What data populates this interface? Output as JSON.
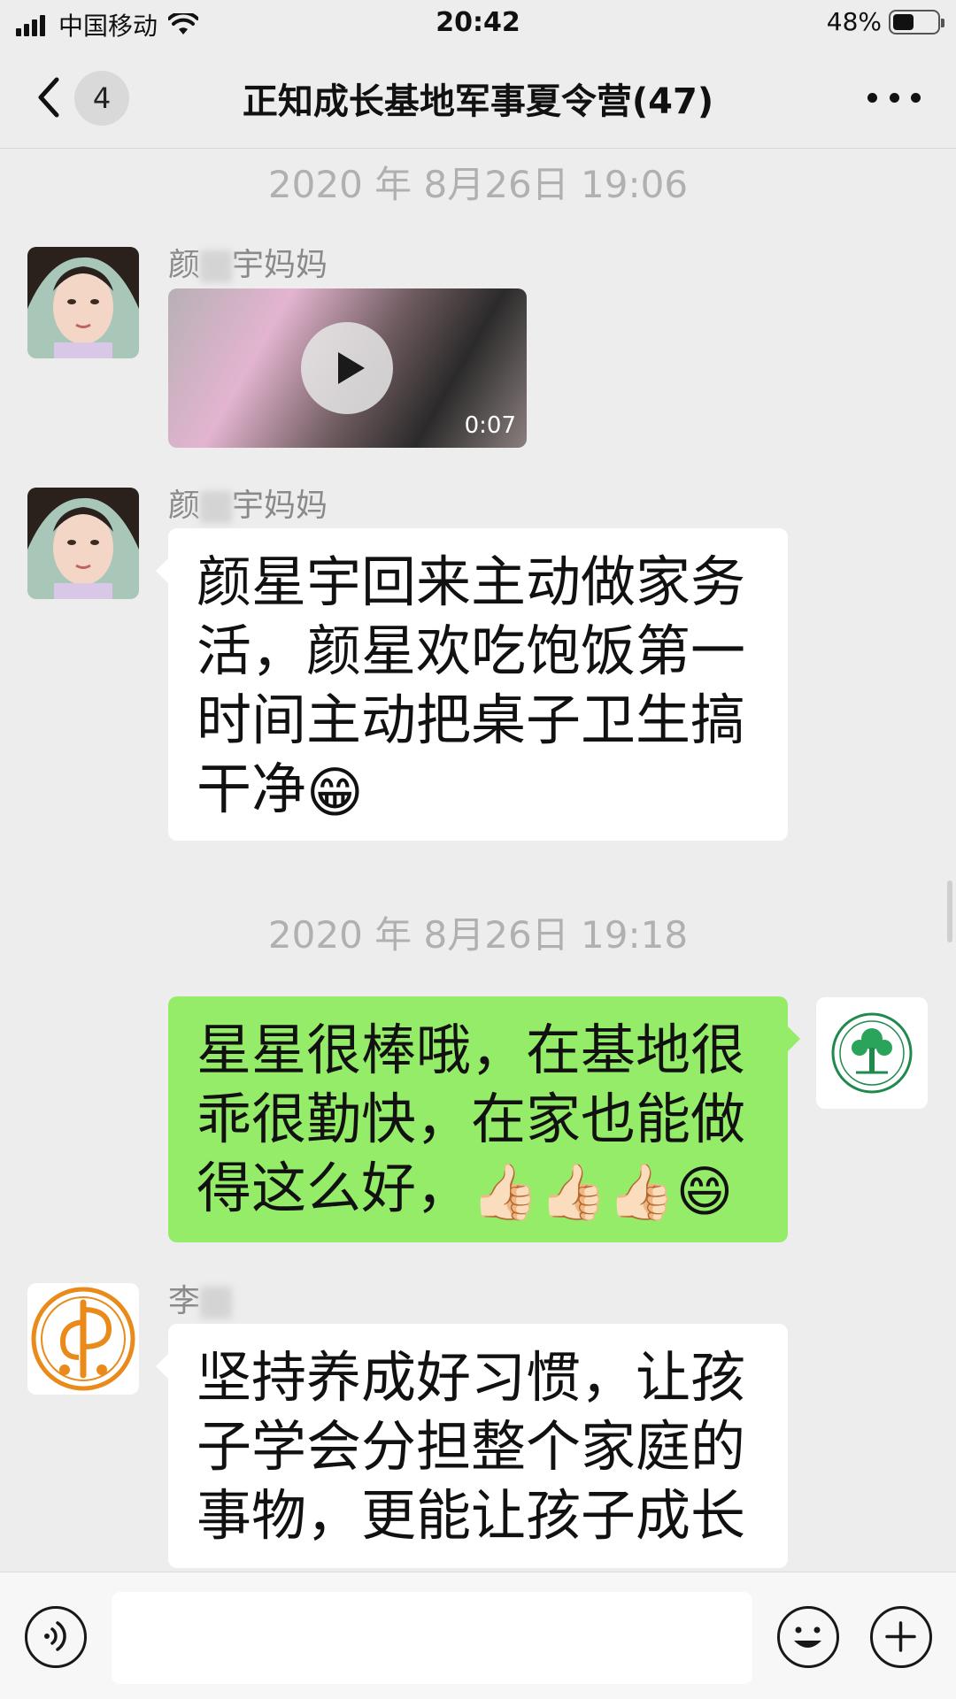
{
  "status_bar": {
    "carrier": "中国移动",
    "time": "20:42",
    "battery": "48%",
    "battery_level": 0.48,
    "signal_icon": "cellular-signal-icon",
    "wifi_icon": "wifi-icon",
    "battery_icon": "battery-icon"
  },
  "header": {
    "back_icon": "chevron-left-icon",
    "unread_count": "4",
    "title": "正知成长基地军事夏令营(47)",
    "more_icon": "ellipsis-icon"
  },
  "messages": {
    "ts1": "2020 年 8月26日 19:06",
    "m1": {
      "sender": "颜",
      "sender_suffix": "宇妈妈",
      "duration": "0:07"
    },
    "m2": {
      "sender": "颜",
      "sender_suffix": "宇妈妈",
      "line1": "颜星宇回来主动做家务",
      "line2": "活，颜星欢吃饱饭第一",
      "line3": "时间主动把桌子卫生搞",
      "line4": "干净",
      "emoji": "😁"
    },
    "ts2": "2020 年 8月26日 19:18",
    "m3": {
      "line1": "星星很棒哦，在基地很",
      "line2": "乖很勤快，在家也能做",
      "line3": "得这么好，",
      "emoji": "👍🏻👍🏻👍🏻😄"
    },
    "m4": {
      "sender": "李",
      "line1": "坚持养成好习惯，让孩",
      "line2": "子学会分担整个家庭的",
      "line3": "事物，更能让孩子成长"
    }
  },
  "input_bar": {
    "voice_icon": "voice-icon",
    "emoji_icon": "smiley-icon",
    "plus_icon": "plus-icon",
    "placeholder": ""
  },
  "colors": {
    "background": "#ededed",
    "bubble_self": "#95ec69",
    "bubble_other": "#ffffff",
    "timestamp": "#b0b0b0"
  }
}
